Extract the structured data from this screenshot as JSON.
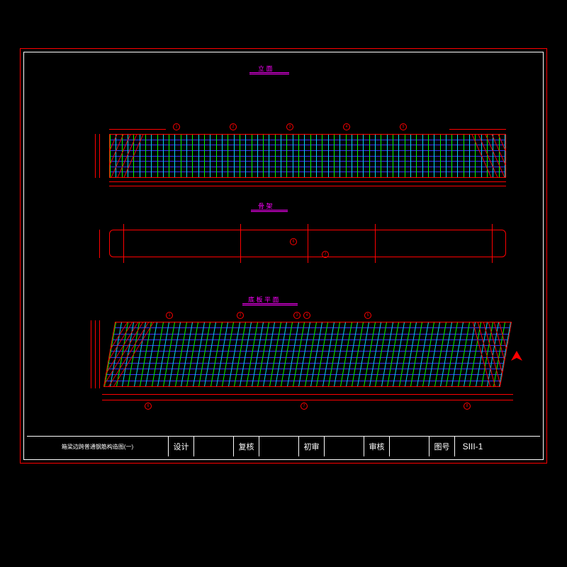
{
  "titles": {
    "view1": "立  面",
    "view2": "骨  架",
    "view3": "底 板 平 面"
  },
  "title_block": {
    "drawing_title": "箱梁边跨普通钢筋构造图(一)",
    "cells": [
      {
        "label": "设计",
        "value": ""
      },
      {
        "label": "复核",
        "value": ""
      },
      {
        "label": "初审",
        "value": ""
      },
      {
        "label": "审核",
        "value": ""
      }
    ],
    "num_label": "图号",
    "num_value": "SIII-1"
  },
  "colors": {
    "frame": "#ff0000",
    "rebar1": "#00ff00",
    "rebar2": "#00e0e0",
    "longitudinal": "#3838ff",
    "title": "#ff00ff"
  },
  "chart_data": {
    "type": "diagram",
    "description": "Structural rebar layout drawing for box girder side span",
    "views": [
      {
        "name": "立面",
        "kind": "elevation",
        "rebar_pattern": "vertical stirrups alternating green/cyan with blue longitudinal bars, leader callouts 1-8, angled red hooks each end"
      },
      {
        "name": "骨架",
        "kind": "frame/skeleton",
        "shape": "rounded-rect outline with 5 vertical ties, leader callouts"
      },
      {
        "name": "底板平面",
        "kind": "bottom-slab plan",
        "rebar_pattern": "skewed plan with vertical stirrups green/cyan, blue longitudinal bars, end-zone angled bars, leader callouts"
      }
    ],
    "dimensions_note": "Fine red dimension strings along top/bottom/left of each view; values illegible at source resolution",
    "callout_numbers": [
      1,
      2,
      3,
      4,
      5,
      6,
      7,
      8
    ]
  }
}
